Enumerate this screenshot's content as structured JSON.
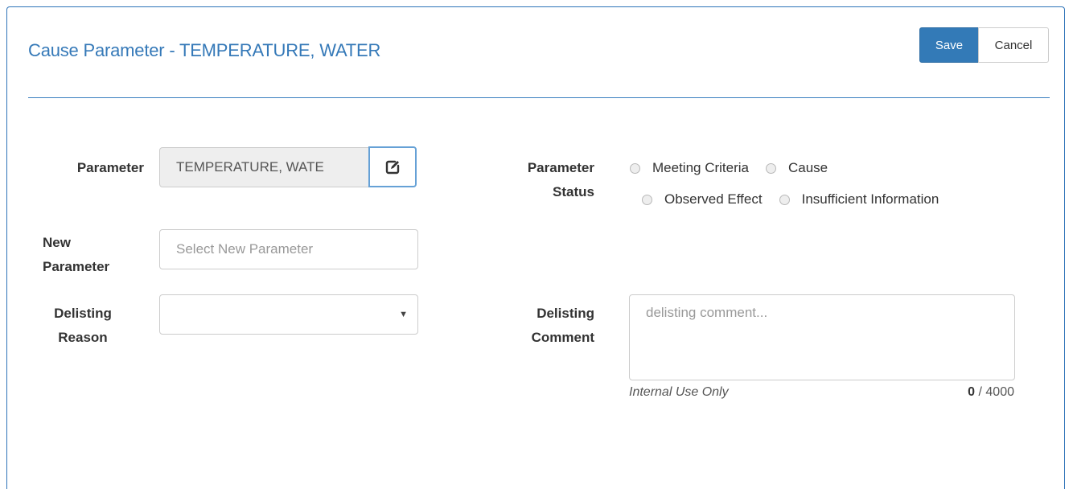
{
  "header": {
    "title": "Cause Parameter - TEMPERATURE, WATER",
    "save_label": "Save",
    "cancel_label": "Cancel"
  },
  "form": {
    "parameter": {
      "label": "Parameter",
      "value": "TEMPERATURE, WATE",
      "edit_icon": "edit-icon"
    },
    "new_parameter": {
      "label_line1": "New",
      "label_line2": "Parameter",
      "placeholder": "Select New Parameter"
    },
    "delisting_reason": {
      "label_line1": "Delisting",
      "label_line2": "Reason",
      "value": ""
    },
    "parameter_status": {
      "label_line1": "Parameter",
      "label_line2": "Status",
      "options": [
        "Meeting Criteria",
        "Cause",
        "Observed Effect",
        "Insufficient Information"
      ]
    },
    "delisting_comment": {
      "label_line1": "Delisting",
      "label_line2": "Comment",
      "placeholder": "delisting comment...",
      "help": "Internal Use Only",
      "count": "0",
      "max": "/ 4000"
    }
  },
  "colors": {
    "primary": "#337ab7",
    "title": "#3579b8",
    "border": "#2e73b8"
  }
}
